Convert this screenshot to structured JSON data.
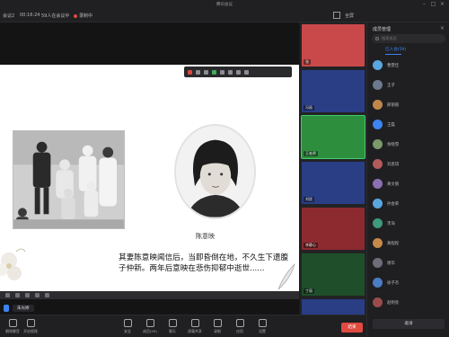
{
  "window": {
    "title": "腾讯会议"
  },
  "infobar": {
    "left_label": "会议2",
    "duration": "00:16:24",
    "participants": "59人在会议中",
    "recording": "录制中"
  },
  "topright": {
    "fullscreen_label": "全屏"
  },
  "slide": {
    "portrait_caption": "陈意映",
    "body_text": "其妻陈意映闻信后，当即昏倒在地，不久生下遗腹子仲新。两年后意映在悲伤抑郁中逝世......"
  },
  "presenter": {
    "name": "朱光婷"
  },
  "tiles": [
    {
      "name": "张",
      "bg": "#c9494a"
    },
    {
      "name": "冯丽",
      "bg": "#2a3e86"
    },
    {
      "name": "王老师",
      "bg": "#2d8f3d"
    },
    {
      "name": "刘欣",
      "bg": "#2a3e86"
    },
    {
      "name": "李静心",
      "bg": "#8c2a2f"
    },
    {
      "name": "丁丽",
      "bg": "#1f4f2a"
    },
    {
      "name": "",
      "bg": "#2a3e86"
    }
  ],
  "panel": {
    "title": "成员管理",
    "search_placeholder": "搜索成员",
    "tab": "已入会(59)",
    "members": [
      {
        "name": "曹雯佳",
        "color": "#5aa7e0"
      },
      {
        "name": "王子",
        "color": "#6b7a8f"
      },
      {
        "name": "邢丽丽",
        "color": "#c0874b"
      },
      {
        "name": "王磊",
        "color": "#3d84f0"
      },
      {
        "name": "余晓雪",
        "color": "#7a9a6b"
      },
      {
        "name": "刘思琪",
        "color": "#b45a5a"
      },
      {
        "name": "黄文丽",
        "color": "#8a6fb3"
      },
      {
        "name": "孙会荣",
        "color": "#5aa7e0"
      },
      {
        "name": "李海",
        "color": "#3e9a7a"
      },
      {
        "name": "黄程程",
        "color": "#c7894a"
      },
      {
        "name": "谢华",
        "color": "#6d6d7a"
      },
      {
        "name": "徐子杰",
        "color": "#4c7dc4"
      },
      {
        "name": "赵明亮",
        "color": "#9a4c4c"
      }
    ],
    "button": "邀请"
  },
  "controls": {
    "mic_label": "解除静音",
    "video_label": "开启视频",
    "items": [
      {
        "label": "安全",
        "name": "security-button"
      },
      {
        "label": "成员(59)",
        "name": "members-button"
      },
      {
        "label": "聊天",
        "name": "chat-button"
      },
      {
        "label": "屏幕共享",
        "name": "share-screen-button"
      },
      {
        "label": "录制",
        "name": "record-button"
      },
      {
        "label": "应用",
        "name": "apps-button"
      },
      {
        "label": "设置",
        "name": "settings-button"
      }
    ],
    "leave_label": "结束"
  }
}
